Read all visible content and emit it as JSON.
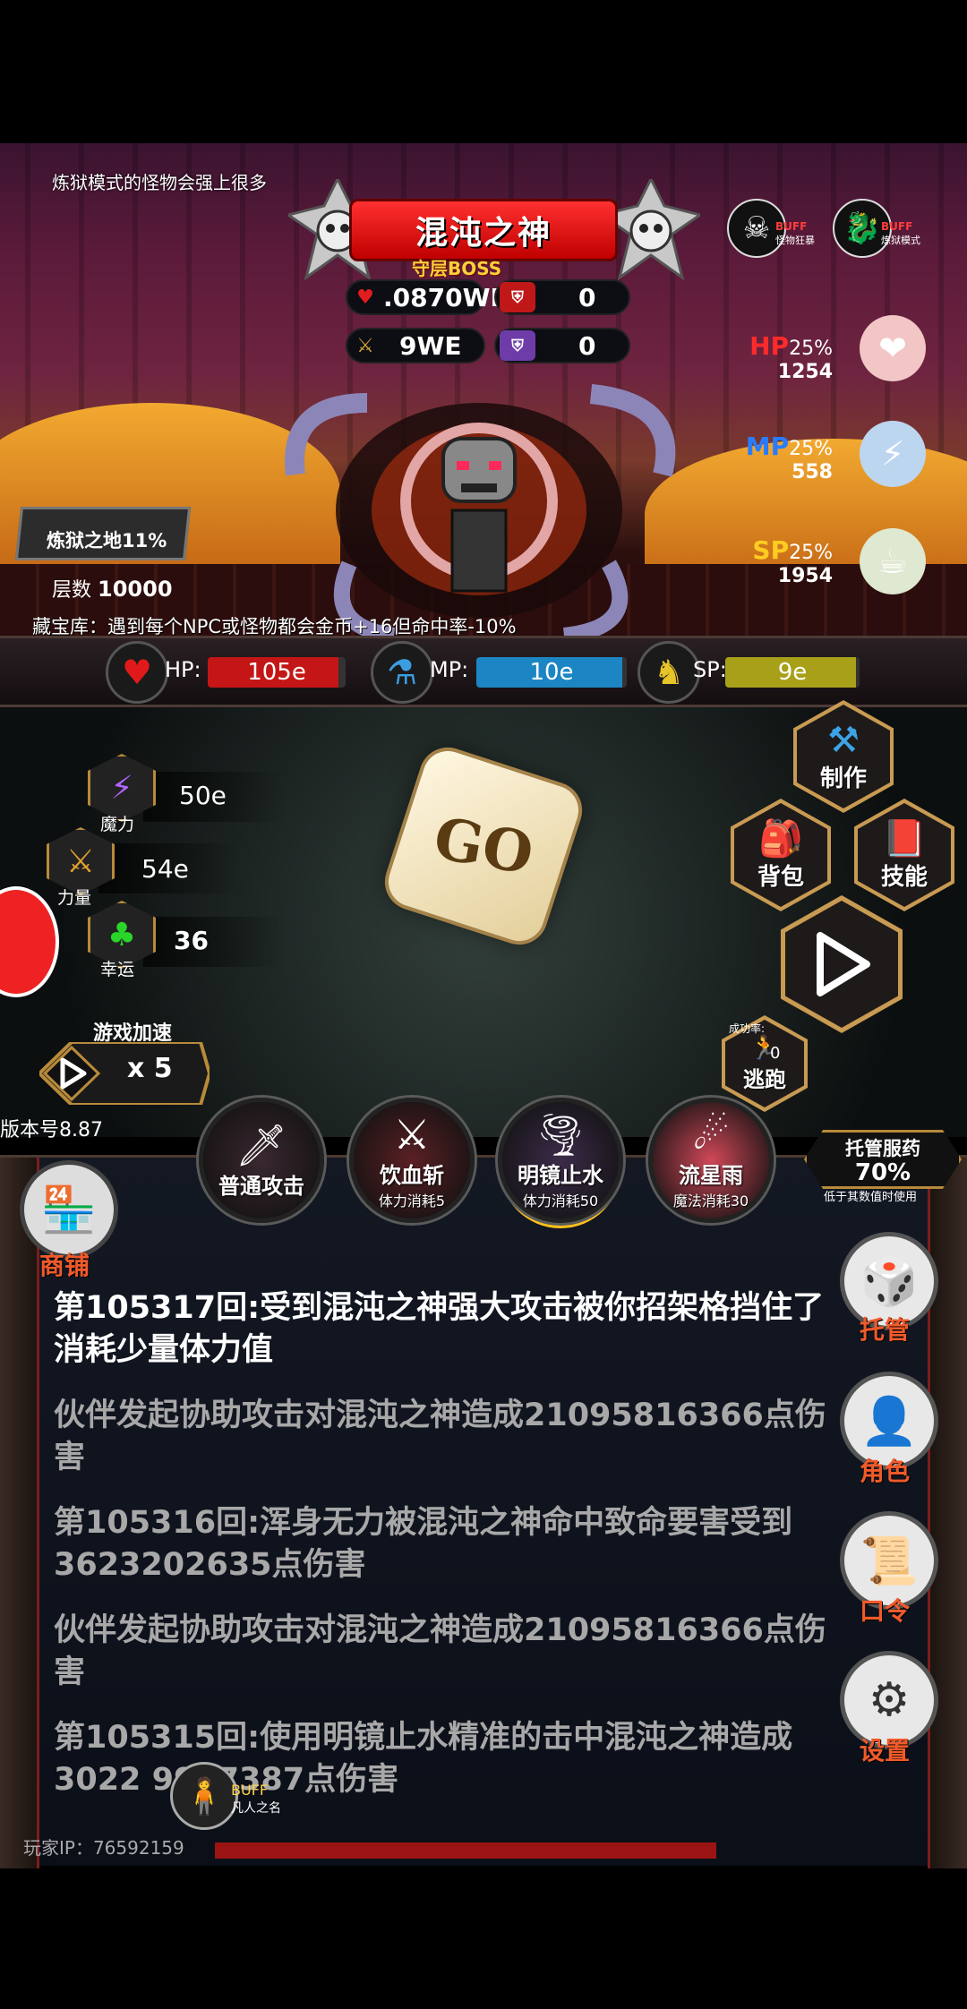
{
  "scene": {
    "hint": "炼狱模式的怪物会强上很多",
    "boss": {
      "name": "混沌之神",
      "subtitle": "守层BOSS",
      "hp": ".0870WE",
      "def": "0",
      "atk": "9WE",
      "mdef": "0"
    },
    "buffs": [
      {
        "tag": "BUFF",
        "name": "怪物狂暴",
        "icon": "skull-icon"
      },
      {
        "tag": "BUFF",
        "name": "炼狱模式",
        "icon": "dragon-icon"
      }
    ],
    "potions": {
      "hp": {
        "label": "HP",
        "pct": "25%",
        "count": "1254",
        "color": "#ff2a2a"
      },
      "mp": {
        "label": "MP",
        "pct": "25%",
        "count": "558",
        "color": "#2a7cff"
      },
      "sp": {
        "label": "SP",
        "pct": "25%",
        "count": "1954",
        "color": "#ffcc22"
      }
    },
    "floor": {
      "name": "炼狱之地11%",
      "level_label": "层数",
      "level": "10000"
    },
    "treasure": "藏宝库：遇到每个NPC或怪物都会金币+16但命中率-10%"
  },
  "bars": {
    "hp": {
      "label": "HP:",
      "value": "105e",
      "fill": 0.95,
      "color": "#c41616"
    },
    "mp": {
      "label": "MP:",
      "value": "10e",
      "fill": 0.97,
      "color": "#1c86c4"
    },
    "sp": {
      "label": "SP:",
      "value": "9e",
      "fill": 0.97,
      "color": "#a8a018"
    }
  },
  "attributes": [
    {
      "name": "魔力",
      "value": "50e",
      "icon": "lightning-icon"
    },
    {
      "name": "力量",
      "value": "54e",
      "icon": "sword-icon"
    },
    {
      "name": "幸运",
      "value": "36",
      "icon": "clover-icon"
    }
  ],
  "dice": {
    "label": "GO"
  },
  "menu": {
    "craft": "制作",
    "bag": "背包",
    "skills": "技能"
  },
  "speed": {
    "label": "游戏加速",
    "mult": "x 5"
  },
  "escape": {
    "rate_label": "成功率:",
    "rate": "0",
    "label": "逃跑"
  },
  "version": "版本号8.87",
  "skills": [
    {
      "name": "普通攻击",
      "cost": "",
      "bg": "#3a2830"
    },
    {
      "name": "饮血斩",
      "cost": "体力消耗5",
      "bg": "#5a2024"
    },
    {
      "name": "明镜止水",
      "cost": "体力消耗50",
      "bg": "#3c2c4a"
    },
    {
      "name": "流星雨",
      "cost": "魔法消耗30",
      "bg": "#d04858"
    }
  ],
  "auto_potion": {
    "title": "托管服药",
    "pct": "70%",
    "note": "低于其数值时使用"
  },
  "shop": {
    "label": "商铺"
  },
  "log": [
    {
      "text": "第105317回:受到混沌之神强大攻击被你招架格挡住了消耗少量体力值",
      "color": "#ffffff"
    },
    {
      "text": "伙伴发起协助攻击对混沌之神造成21095816366点伤害",
      "color": "#a8a8a8"
    },
    {
      "text": "第105316回:浑身无力被混沌之神命中致命要害受到3623202635点伤害",
      "color": "#a8a8a8"
    },
    {
      "text": "伙伴发起协助攻击对混沌之神造成21095816366点伤害",
      "color": "#a8a8a8"
    },
    {
      "text": "第105315回:使用明镜止水精准的击中混沌之神造成3022 9907387点伤害",
      "color": "#a8a8a8"
    }
  ],
  "side_buttons": {
    "auto": "托管",
    "role": "角色",
    "code": "口令",
    "settings": "设置"
  },
  "player": {
    "ip": "玩家IP：76592159",
    "buff_tag": "BUFF",
    "buff_name": "凡人之名"
  }
}
